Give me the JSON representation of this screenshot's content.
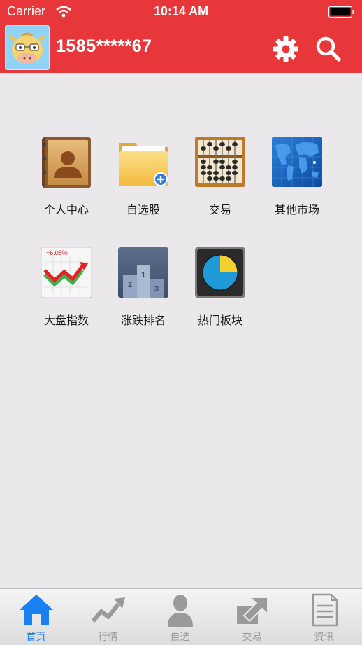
{
  "status_bar": {
    "carrier": "Carrier",
    "time": "10:14 AM"
  },
  "header": {
    "username": "1585*****67"
  },
  "tiles": [
    {
      "label": "个人中心",
      "icon": "contacts-book-icon"
    },
    {
      "label": "自选股",
      "icon": "folder-add-icon"
    },
    {
      "label": "交易",
      "icon": "abacus-icon"
    },
    {
      "label": "其他市场",
      "icon": "world-map-icon"
    },
    {
      "label": "大盘指数",
      "icon": "index-chart-icon",
      "badge": "+6.08%"
    },
    {
      "label": "涨跌排名",
      "icon": "podium-icon"
    },
    {
      "label": "热门板块",
      "icon": "pie-chart-icon"
    }
  ],
  "tabbar": {
    "items": [
      {
        "label": "首页",
        "icon": "home-icon",
        "active": true
      },
      {
        "label": "行情",
        "icon": "trend-icon",
        "active": false
      },
      {
        "label": "自选",
        "icon": "person-icon",
        "active": false
      },
      {
        "label": "交易",
        "icon": "exchange-icon",
        "active": false
      },
      {
        "label": "资讯",
        "icon": "document-icon",
        "active": false
      }
    ]
  },
  "colors": {
    "header": "#e8373a",
    "tab_active": "#1a7ff0",
    "tab_inactive": "#9a9a9a",
    "background": "#ebe8eb"
  }
}
